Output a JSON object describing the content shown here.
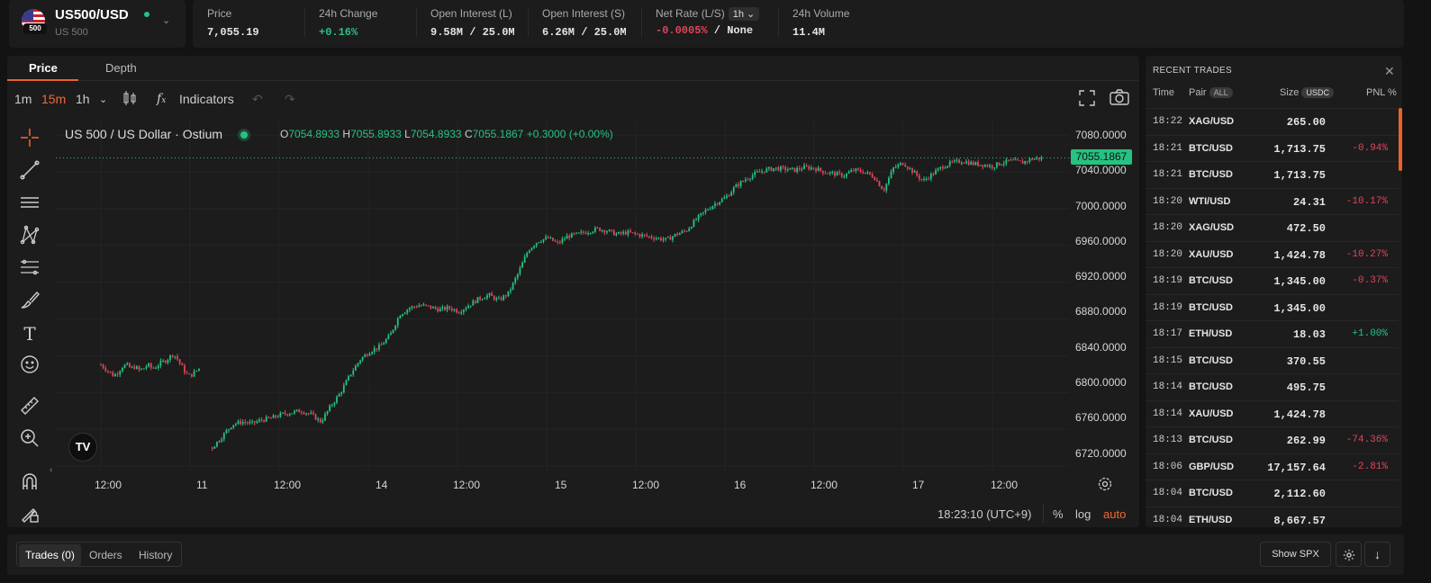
{
  "asset": {
    "symbol": "US500/USD",
    "name": "US 500",
    "flag_badge": "500"
  },
  "stats": [
    {
      "label": "Price",
      "value": "7,055.19",
      "tone": "neutral"
    },
    {
      "label": "24h Change",
      "value": "+0.16%",
      "tone": "up"
    },
    {
      "label": "Open Interest (L)",
      "value": "9.58M / 25.0M",
      "tone": "neutral"
    },
    {
      "label": "Open Interest (S)",
      "value": "6.26M / 25.0M",
      "tone": "neutral"
    },
    {
      "label": "Net Rate (L/S)",
      "value_neg": "-0.0005%",
      "value_rest": " / None",
      "interval": "1h"
    },
    {
      "label": "24h Volume",
      "value": "11.4M",
      "tone": "neutral"
    }
  ],
  "chart_tabs": [
    "Price",
    "Depth"
  ],
  "toolbar": {
    "intervals": [
      "1m",
      "15m",
      "1h"
    ],
    "active_interval": "15m",
    "indicators": "Indicators"
  },
  "legend": {
    "title": "US 500 / US Dollar · Ostium",
    "o_label": "O",
    "o": "7054.8933",
    "h_label": "H",
    "h": "7055.8933",
    "l_label": "L",
    "l": "7054.8933",
    "c_label": "C",
    "c": "7055.1867",
    "change": "+0.3000 (+0.00%)"
  },
  "price_tag": "7055.1867",
  "price_axis": [
    "7080.0000",
    "7040.0000",
    "7000.0000",
    "6960.0000",
    "6920.0000",
    "6880.0000",
    "6840.0000",
    "6800.0000",
    "6760.0000",
    "6720.0000"
  ],
  "time_axis": [
    "12:00",
    "11",
    "12:00",
    "14",
    "12:00",
    "15",
    "12:00",
    "16",
    "12:00",
    "17",
    "12:00"
  ],
  "chart_footer": {
    "clock": "18:23:10 (UTC+9)",
    "percent": "%",
    "log": "log",
    "auto": "auto"
  },
  "colors": {
    "up": "#26c281",
    "down": "#e0455a",
    "accent": "#e8632c"
  },
  "chart_data": {
    "type": "line",
    "title": "US 500 / US Dollar · Ostium",
    "ylim": [
      6710,
      7090
    ],
    "x": [
      "12:00",
      "11",
      "12:00",
      "14",
      "12:00",
      "15",
      "12:00",
      "16",
      "12:00",
      "17",
      "12:00"
    ],
    "segments": [
      {
        "from": 0.0,
        "to": 1.1,
        "values": [
          6830,
          6826,
          6822,
          6818,
          6822,
          6828,
          6830,
          6826,
          6828,
          6824,
          6826,
          6830,
          6826,
          6828,
          6832,
          6834,
          6838,
          6842,
          6836,
          6828,
          6820,
          6818,
          6822,
          6826
        ]
      },
      {
        "from": 1.25,
        "to": 10.55,
        "values": [
          6740,
          6752,
          6765,
          6768,
          6766,
          6770,
          6772,
          6776,
          6778,
          6780,
          6776,
          6768,
          6785,
          6800,
          6820,
          6836,
          6845,
          6850,
          6862,
          6885,
          6892,
          6895,
          6893,
          6890,
          6892,
          6888,
          6895,
          6902,
          6906,
          6900,
          6908,
          6930,
          6955,
          6965,
          6968,
          6962,
          6970,
          6972,
          6975,
          6978,
          6976,
          6972,
          6974,
          6972,
          6970,
          6968,
          6966,
          6972,
          6976,
          6988,
          6998,
          7006,
          7012,
          7024,
          7032,
          7038,
          7042,
          7044,
          7043,
          7042,
          7045,
          7044,
          7040,
          7038,
          7036,
          7042,
          7040,
          7035,
          7020,
          7044,
          7050,
          7040,
          7030,
          7038,
          7046,
          7050,
          7052,
          7049,
          7048,
          7046,
          7050,
          7052,
          7050,
          7054,
          7055
        ]
      }
    ],
    "last": 7055.1867
  },
  "recent_trades": {
    "title": "RECENT TRADES",
    "columns": {
      "time": "Time",
      "pair": "Pair",
      "pair_badge": "ALL",
      "size": "Size",
      "size_badge": "USDC",
      "pnl": "PNL %"
    },
    "rows": [
      {
        "time": "18:22",
        "pair": "XAG/USD",
        "size": "265.00",
        "pnl": ""
      },
      {
        "time": "18:21",
        "pair": "BTC/USD",
        "size": "1,713.75",
        "pnl": "-0.94%"
      },
      {
        "time": "18:21",
        "pair": "BTC/USD",
        "size": "1,713.75",
        "pnl": ""
      },
      {
        "time": "18:20",
        "pair": "WTI/USD",
        "size": "24.31",
        "pnl": "-10.17%"
      },
      {
        "time": "18:20",
        "pair": "XAG/USD",
        "size": "472.50",
        "pnl": ""
      },
      {
        "time": "18:20",
        "pair": "XAU/USD",
        "size": "1,424.78",
        "pnl": "-10.27%"
      },
      {
        "time": "18:19",
        "pair": "BTC/USD",
        "size": "1,345.00",
        "pnl": "-0.37%"
      },
      {
        "time": "18:19",
        "pair": "BTC/USD",
        "size": "1,345.00",
        "pnl": ""
      },
      {
        "time": "18:17",
        "pair": "ETH/USD",
        "size": "18.03",
        "pnl": "+1.00%"
      },
      {
        "time": "18:15",
        "pair": "BTC/USD",
        "size": "370.55",
        "pnl": ""
      },
      {
        "time": "18:14",
        "pair": "BTC/USD",
        "size": "495.75",
        "pnl": ""
      },
      {
        "time": "18:14",
        "pair": "XAU/USD",
        "size": "1,424.78",
        "pnl": ""
      },
      {
        "time": "18:13",
        "pair": "BTC/USD",
        "size": "262.99",
        "pnl": "-74.36%"
      },
      {
        "time": "18:06",
        "pair": "GBP/USD",
        "size": "17,157.64",
        "pnl": "-2.81%"
      },
      {
        "time": "18:04",
        "pair": "BTC/USD",
        "size": "2,112.60",
        "pnl": ""
      },
      {
        "time": "18:04",
        "pair": "ETH/USD",
        "size": "8,667.57",
        "pnl": ""
      }
    ]
  },
  "bottom": {
    "tabs": [
      "Trades (0)",
      "Orders",
      "History"
    ],
    "show_spx": "Show SPX"
  }
}
